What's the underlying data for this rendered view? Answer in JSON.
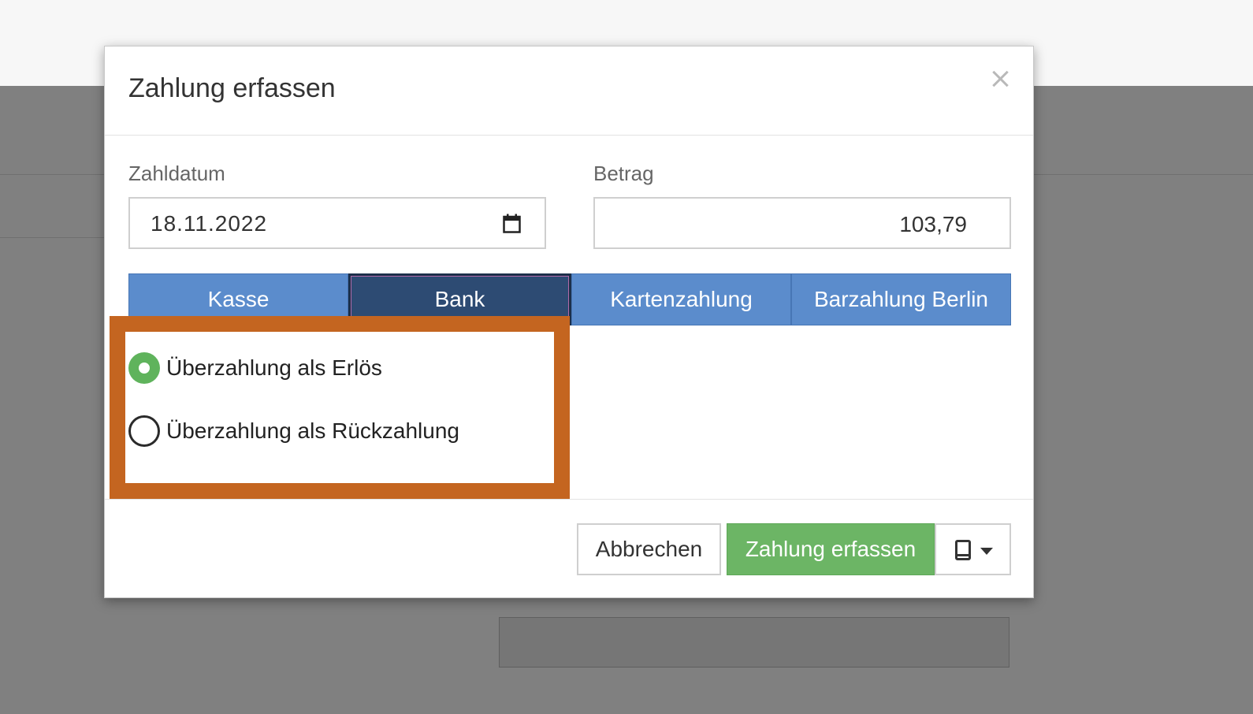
{
  "dialog": {
    "title": "Zahlung erfassen",
    "close_label": "×"
  },
  "form": {
    "date_label": "Zahldatum",
    "date_value": "18.11.2022",
    "amount_label": "Betrag",
    "amount_value": "103,79"
  },
  "tabs": [
    {
      "label": "Kasse",
      "active": false
    },
    {
      "label": "Bank",
      "active": true
    },
    {
      "label": "Kartenzahlung",
      "active": false
    },
    {
      "label": "Barzahlung Berlin",
      "active": false
    }
  ],
  "options": [
    {
      "label": "Überzahlung als Erlös",
      "checked": true
    },
    {
      "label": "Überzahlung als Rückzahlung",
      "checked": false
    }
  ],
  "footer": {
    "cancel_label": "Abbrechen",
    "submit_label": "Zahlung erfassen"
  },
  "colors": {
    "tab": "#5b8ccc",
    "tab_active": "#2d4b73",
    "submit": "#6cb565",
    "highlight": "#c46520"
  }
}
